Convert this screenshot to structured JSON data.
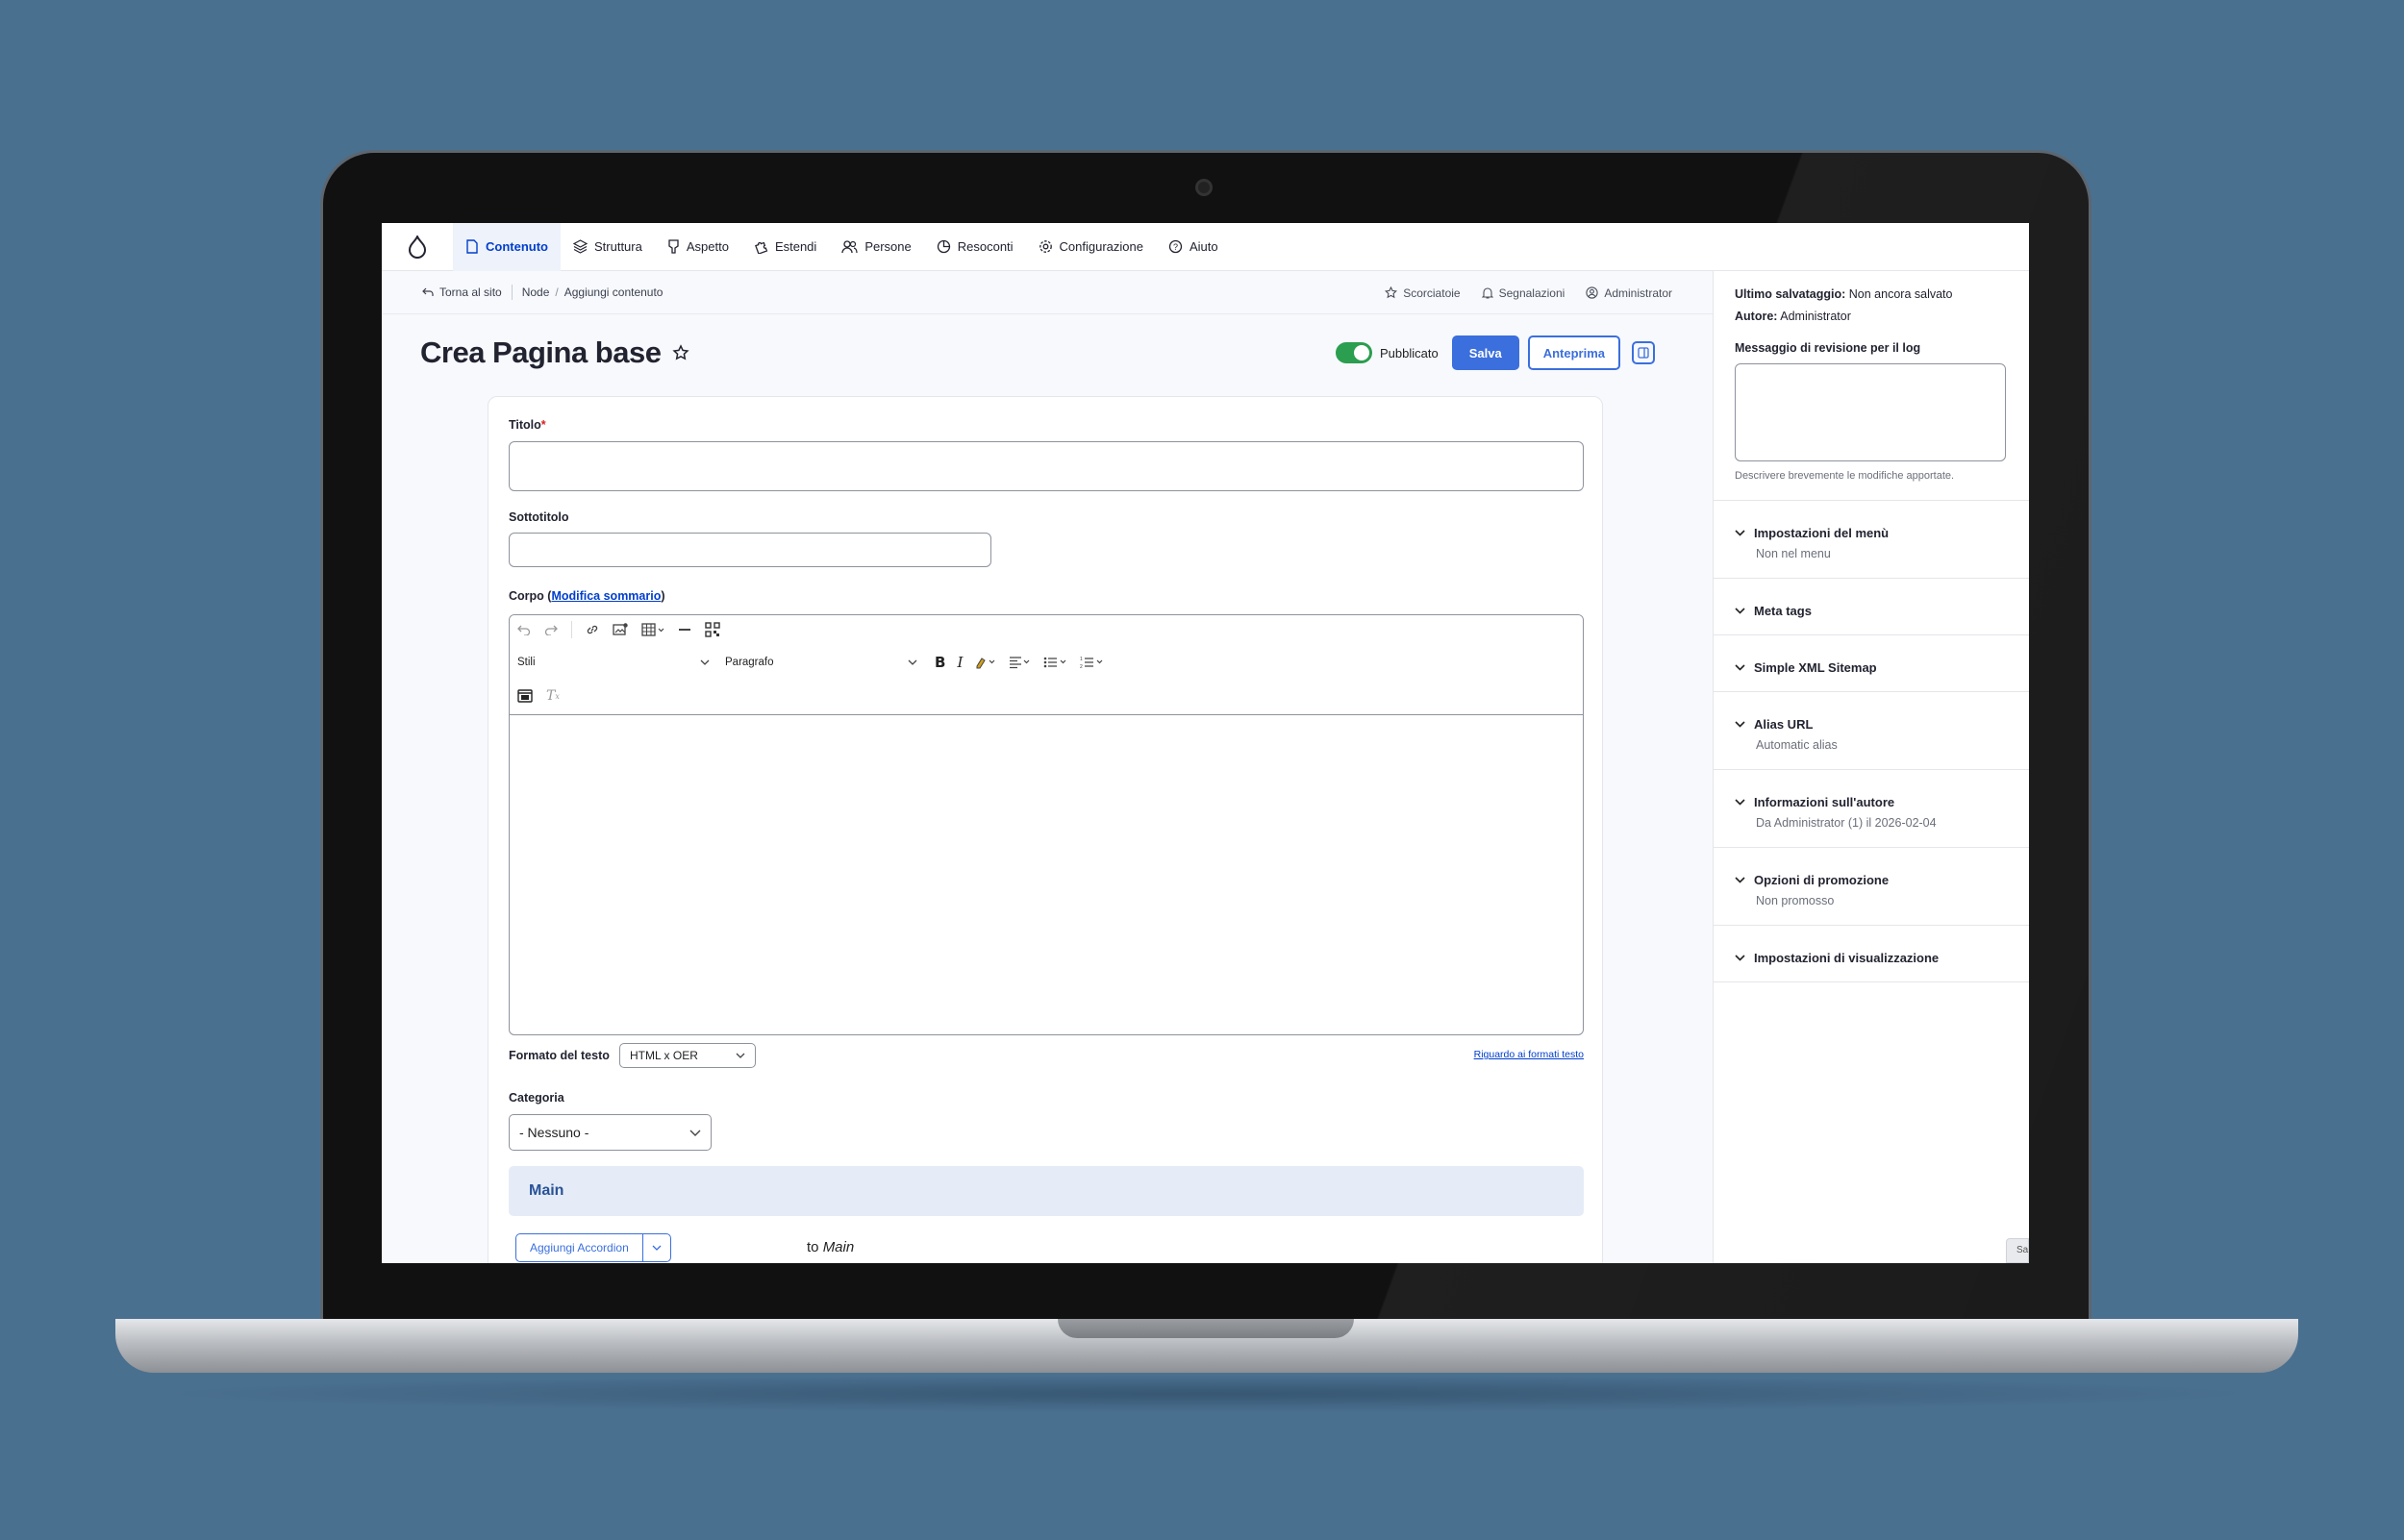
{
  "toolbar": {
    "items": [
      {
        "label": "Contenuto",
        "icon": "file-icon",
        "active": true
      },
      {
        "label": "Struttura",
        "icon": "layers-icon"
      },
      {
        "label": "Aspetto",
        "icon": "brush-icon"
      },
      {
        "label": "Estendi",
        "icon": "puzzle-icon"
      },
      {
        "label": "Persone",
        "icon": "people-icon"
      },
      {
        "label": "Resoconti",
        "icon": "chart-pie-icon"
      },
      {
        "label": "Configurazione",
        "icon": "gear-icon"
      },
      {
        "label": "Aiuto",
        "icon": "help-icon"
      }
    ]
  },
  "breadcrumb": {
    "back": "Torna al sito",
    "items": [
      "Node",
      "Aggiungi contenuto"
    ]
  },
  "topbar": {
    "shortcuts": "Scorciatoie",
    "notifications": "Segnalazioni",
    "user": "Administrator"
  },
  "page": {
    "title": "Crea Pagina base",
    "published_label": "Pubblicato",
    "save_label": "Salva",
    "preview_label": "Anteprima"
  },
  "form": {
    "title_label": "Titolo",
    "title_required": "*",
    "subtitle_label": "Sottotitolo",
    "body_label_prefix": "Corpo (",
    "body_label_link": "Modifica sommario",
    "body_label_suffix": ")",
    "editor": {
      "styles_select": "Stili",
      "paragraph_select": "Paragrafo"
    },
    "text_format_label": "Formato del testo",
    "text_format_value": "HTML x OER",
    "text_format_help": "Riguardo ai formati testo",
    "category_label": "Categoria",
    "category_value": "- Nessuno -",
    "region_title": "Main",
    "add_button_label": "Aggiungi Accordion",
    "to_prefix": "to",
    "to_region": "Main"
  },
  "sidebar": {
    "last_saved_label": "Ultimo salvataggio:",
    "last_saved_value": "Non ancora salvato",
    "author_label": "Autore:",
    "author_value": "Administrator",
    "revision_label": "Messaggio di revisione per il log",
    "revision_help": "Descrivere brevemente le modifiche apportate.",
    "sections": [
      {
        "title": "Impostazioni del menù",
        "summary": "Non nel menu"
      },
      {
        "title": "Meta tags",
        "summary": ""
      },
      {
        "title": "Simple XML Sitemap",
        "summary": ""
      },
      {
        "title": "Alias URL",
        "summary": "Automatic alias"
      },
      {
        "title": "Informazioni sull'autore",
        "summary": "Da Administrator (1) il 2026-02-04"
      },
      {
        "title": "Opzioni di promozione",
        "summary": "Non promosso"
      },
      {
        "title": "Impostazioni di visualizzazione",
        "summary": ""
      }
    ],
    "corner_tab": "Sa"
  },
  "colors": {
    "accent": "#3b6fdd",
    "active_nav": "#003ecc",
    "toggle_on": "#2b9e4f",
    "background": "#4a7090"
  }
}
